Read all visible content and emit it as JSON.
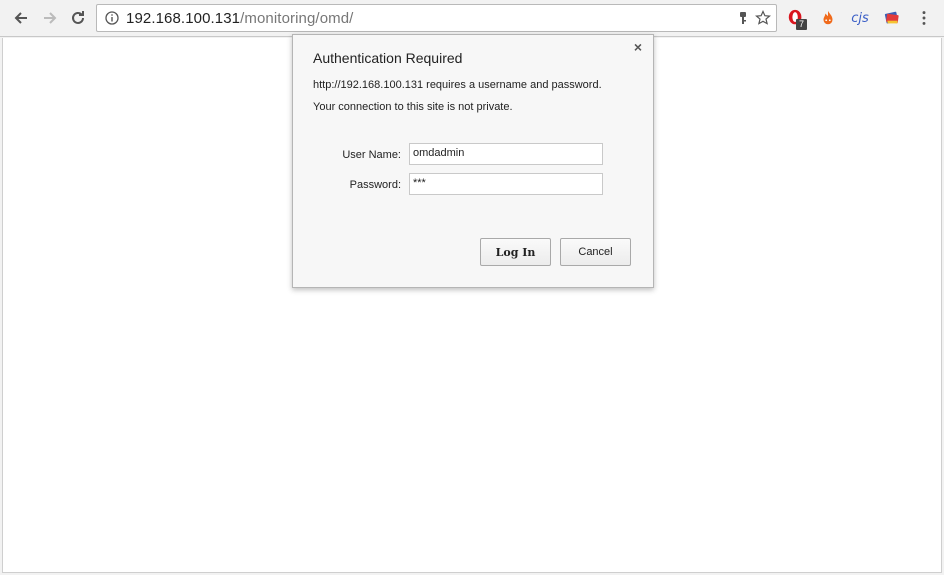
{
  "browser": {
    "url_host": "192.168.100.131",
    "url_path": "/monitoring/omd/",
    "extensions": [
      {
        "name": "opera-extension-icon",
        "badge": "7"
      },
      {
        "name": "fire-extension-icon"
      },
      {
        "name": "cjs-extension-icon",
        "label": "cjs"
      },
      {
        "name": "book-extension-icon"
      }
    ]
  },
  "dialog": {
    "title": "Authentication Required",
    "message_line1": "http://192.168.100.131 requires a username and password.",
    "message_line2": "Your connection to this site is not private.",
    "username_label": "User Name:",
    "username_value": "omdadmin",
    "password_label": "Password:",
    "password_value": "***",
    "login_label": "Log In",
    "cancel_label": "Cancel",
    "close_glyph": "×"
  }
}
